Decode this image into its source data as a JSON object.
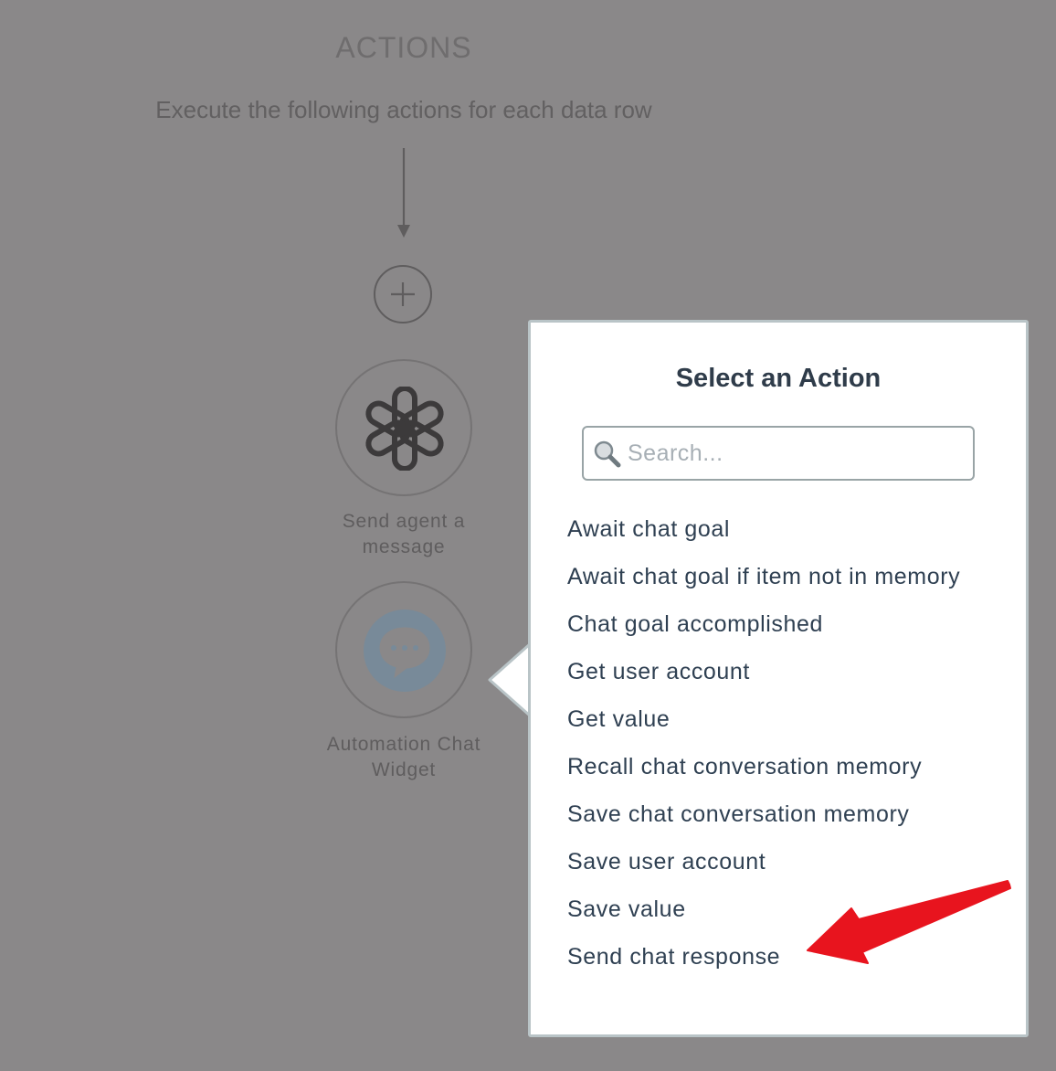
{
  "actions_section": {
    "title": "ACTIONS",
    "subtitle": "Execute the following actions for each data row"
  },
  "nodes": [
    {
      "label_line1": "Send agent a",
      "label_line2": "message",
      "icon": "openai-logo-icon"
    },
    {
      "label_line1": "Automation Chat",
      "label_line2": "Widget",
      "icon": "chat-bubble-icon"
    }
  ],
  "popover": {
    "title": "Select an Action",
    "search_placeholder": "Search...",
    "search_value": "",
    "actions": [
      "Await chat goal",
      "Await chat goal if item not in memory",
      "Chat goal accomplished",
      "Get user account",
      "Get value",
      "Recall chat conversation memory",
      "Save chat conversation memory",
      "Save user account",
      "Save value",
      "Send chat response"
    ]
  },
  "icons": {
    "add": "plus-circle-icon",
    "search": "magnifier-icon",
    "annotation": "red-pointer-arrow-icon"
  },
  "colors": {
    "backdrop": "#8a8889",
    "popover_bg": "#ffffff",
    "popover_border": "#b9c4c7",
    "text_dark": "#2f4052",
    "annotation_red": "#e8141e",
    "chat_icon_bg": "#788a99"
  }
}
